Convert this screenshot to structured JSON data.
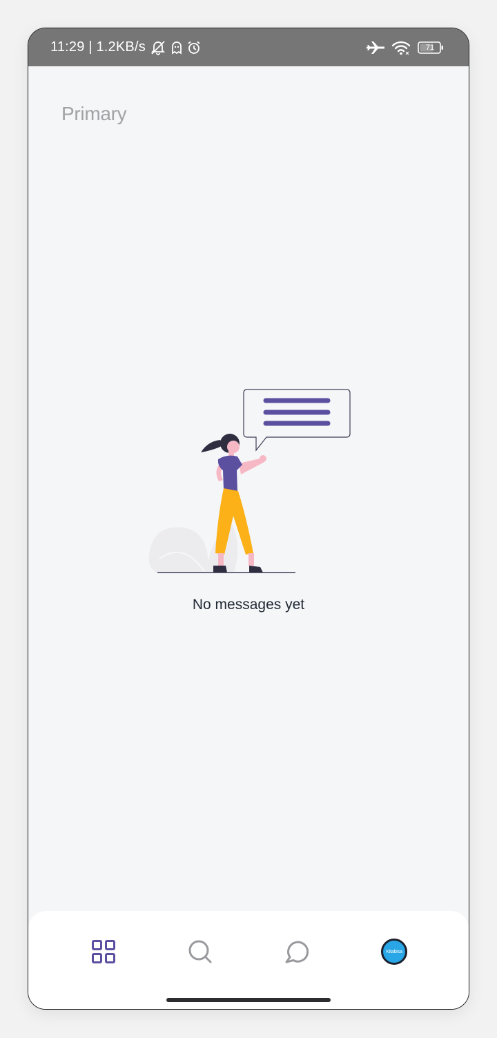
{
  "status_bar": {
    "time_speed": "11:29 | 1.2KB/s",
    "battery_level": "71",
    "icons": [
      "muted-bell-icon",
      "ghost-icon",
      "alarm-icon",
      "airplane-icon",
      "wifi-icon",
      "battery-icon"
    ]
  },
  "header": {
    "title": "Primary"
  },
  "empty_state": {
    "message": "No messages yet",
    "illustration": "woman-speech-bubble-illustration"
  },
  "bottom_nav": {
    "items": [
      {
        "icon": "grid-icon",
        "active": true
      },
      {
        "icon": "search-icon",
        "active": false
      },
      {
        "icon": "chat-icon",
        "active": false
      },
      {
        "icon": "avatar",
        "label": "Kitabisa",
        "active": false
      }
    ]
  },
  "colors": {
    "accent": "#5b4fa0",
    "inactive_icon": "#9a9a9e",
    "status_bar": "#767676",
    "page_background": "#f5f6f8"
  }
}
